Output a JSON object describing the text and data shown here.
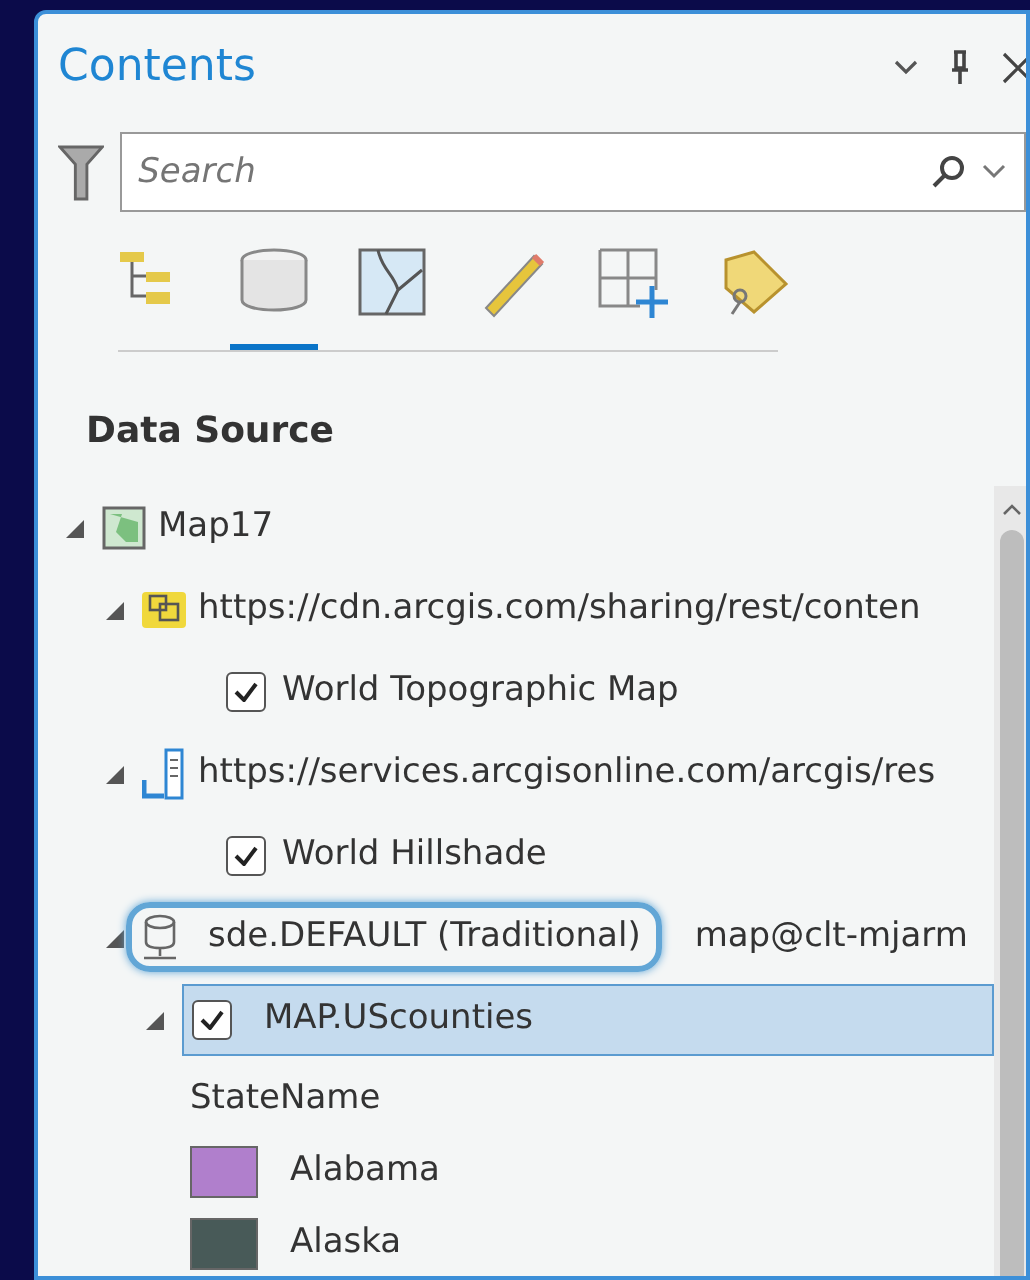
{
  "panel": {
    "title": "Contents"
  },
  "search": {
    "placeholder": "Search"
  },
  "view_tabs": [
    {
      "kind": "hierarchy",
      "selected": false
    },
    {
      "kind": "database",
      "selected": true
    },
    {
      "kind": "map",
      "selected": false
    },
    {
      "kind": "pencil",
      "selected": false
    },
    {
      "kind": "grid",
      "selected": false
    },
    {
      "kind": "tag",
      "selected": false
    }
  ],
  "section_title": "Data Source",
  "tree": [
    {
      "label": "Map17",
      "kind": "map",
      "expanded": true,
      "children": [
        {
          "label": "https://cdn.arcgis.com/sharing/rest/conten",
          "kind": "tile",
          "expanded": true,
          "children": [
            {
              "label": "World Topographic Map",
              "checked": true
            }
          ]
        },
        {
          "label": "https://services.arcgisonline.com/arcgis/res",
          "kind": "service",
          "expanded": true,
          "children": [
            {
              "label": "World Hillshade",
              "checked": true
            }
          ]
        },
        {
          "label": "sde.DEFAULT (Traditional)",
          "detail": "map@clt-mjarm",
          "kind": "database",
          "expanded": true,
          "highlighted": true,
          "children": [
            {
              "label": "MAP.UScounties",
              "checked": true,
              "selected": true,
              "expanded": true,
              "legend": {
                "field": "StateName",
                "classes": [
                  {
                    "label": "Alabama",
                    "color": "#b07fcc"
                  },
                  {
                    "label": "Alaska",
                    "color": "#485a58"
                  }
                ]
              }
            }
          ]
        }
      ]
    }
  ]
}
